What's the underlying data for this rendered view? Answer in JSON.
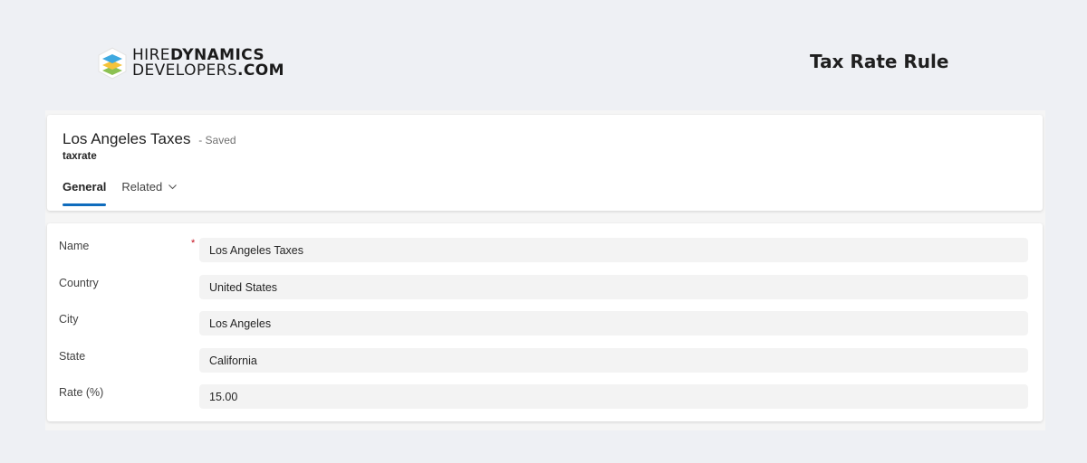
{
  "brand": {
    "line1_light": "HIRE",
    "line1_bold": "DYNAMICS",
    "line2_light": "DEVELOPERS",
    "line2_bold": ".COM",
    "logo_icon": "layered-stack-icon",
    "logo_colors": [
      "#3fa9e0",
      "#f5c33b",
      "#8cc152"
    ]
  },
  "page_heading": "Tax Rate Rule",
  "record": {
    "title": "Los Angeles Taxes",
    "status": "- Saved",
    "entity": "taxrate"
  },
  "tabs": [
    {
      "label": "General",
      "active": true
    },
    {
      "label": "Related",
      "active": false,
      "icon": "chevron-down-icon"
    }
  ],
  "form": {
    "fields": [
      {
        "label": "Name",
        "value": "Los Angeles Taxes",
        "required": true,
        "required_mark": "*"
      },
      {
        "label": "Country",
        "value": "United States"
      },
      {
        "label": "City",
        "value": "Los Angeles"
      },
      {
        "label": "State",
        "value": "California"
      },
      {
        "label": "Rate (%)",
        "value": "15.00"
      }
    ]
  },
  "colors": {
    "accent": "#0f6cbd",
    "required": "#c50f1f",
    "page_background": "#eef0f4"
  }
}
